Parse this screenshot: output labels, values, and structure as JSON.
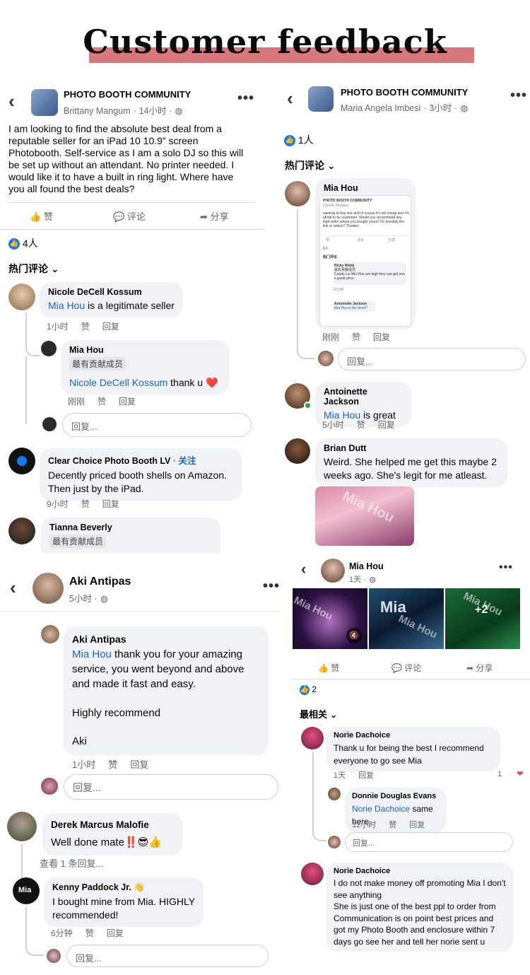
{
  "title": "Customer feedback",
  "p1": {
    "group": "PHOTO BOOTH COMMUNITY",
    "author": "Brittany Mangum",
    "time": "· 14小时 ·",
    "post": "I am looking to find the absolute best deal from a reputable seller for an iPad 10 10.9” screen Photobooth.  Self-service as I am a solo DJ so this will be set up without an attendant.  No printer needed.  I would like it to have a built in ring light. Where have you all found the best deals?",
    "like": "赞",
    "comment": "评论",
    "share": "分享",
    "likes": "4人",
    "sort": "热门评论 ⌄",
    "c1": {
      "name": "Nicole DeCell Kossum",
      "mention": "Mia Hou",
      "text": " is a legitimate seller",
      "time": "1小时",
      "like": "赞",
      "reply": "回复"
    },
    "c2": {
      "name": "Mia Hou",
      "badge": "最有贡献成员",
      "mention": "Nicole DeCell Kossum",
      "text": " thank u ❤️",
      "time": "刚刚",
      "like": "赞",
      "reply": "回复"
    },
    "replyph": "回复...",
    "c3": {
      "name": "Clear Choice Photo Booth LV",
      "follow": " · 关注",
      "text": "Decently priced booth shells on Amazon. Then just by the iPad.",
      "time": "9小时",
      "like": "赞",
      "reply": "回复"
    },
    "c4": {
      "name": "Tianna Beverly",
      "badge": "最有贡献成员"
    }
  },
  "p2": {
    "group": "PHOTO BOOTH COMMUNITY",
    "author": "Maria Angela Imbesi",
    "time": "· 3小时 ·",
    "likes": "1人",
    "sort": "热门评论 ⌄",
    "c1": {
      "name": "Mia Hou",
      "time": "刚刚",
      "like": "赞",
      "reply": "回复"
    },
    "mini": {
      "group": "PHOTO BOOTH COMMUNITY",
      "author": "Camille Morales",
      "post": "wanting to buy one and of course it's not cheap and I'm afraid to be scammed. Would you recommend any legit seller where you bought yours? Or possibly the link or orders? Thanks!",
      "likes": "6人",
      "sort": "热门评论",
      "r1name": "Ricky Webb",
      "r1badge": "最有贡献成员",
      "r1text": "Candy Liu Mia Hou are legit they can get you a great price",
      "r1time": "22分钟",
      "r2name": "Antoinette Jackson",
      "r2text": "Mia Hou is the best!!!",
      "like": "赞",
      "comment": "评论",
      "share": "分享"
    },
    "replyph": "回复...",
    "c2": {
      "name": "Antoinette Jackson",
      "mention": "Mia Hou",
      "text": " is great",
      "time": "5小时",
      "like": "赞",
      "reply": "回复"
    },
    "c3": {
      "name": "Brian Dutt",
      "text": "Weird. She helped me get this maybe 2 weeks ago. She's legit for me atleast."
    },
    "wm": "Mia Hou"
  },
  "p3": {
    "name": "Aki Antipas",
    "time": "5小时 ·",
    "c1": {
      "name": "Aki Antipas",
      "mention": "Mia Hou",
      "text": "  thank you for your amazing service, you went beyond and above and made it fast and easy.",
      "text2": "Highly recommend",
      "text3": "Aki",
      "time": "1小时",
      "like": "赞",
      "reply": "回复"
    },
    "replyph": "回复...",
    "c2": {
      "name": "Derek Marcus Malofie",
      "text": "Well done mate‼️😎👍",
      "more": "查看 1 条回复..."
    },
    "c3": {
      "name": "Kenny Paddock Jr. 👋",
      "text": "I bought mine from Mia. HIGHLY recommended!",
      "time": "6分钟",
      "like": "赞",
      "reply": "回复"
    }
  },
  "p4": {
    "name": "Mia Hou",
    "time": "1天 ·",
    "plus": "+2",
    "imgtext": "Mia",
    "wm": "Mia Hou",
    "like": "赞",
    "comment": "评论",
    "share": "分享",
    "likes": "2",
    "sort": "最相关 ⌄",
    "c1": {
      "name": "Norie Dachoice",
      "text": "Thank u for being the best I recommend everyone to go see Mia",
      "time": "1天",
      "reply": "回复",
      "count": "1"
    },
    "c2": {
      "name": "Donnie Douglas Evans",
      "mention": "Norie Dachoice",
      "text": " same here.",
      "time": "12小时",
      "like": "赞",
      "reply": "回复"
    },
    "replyph": "回复...",
    "c3": {
      "name": "Norie Dachoice",
      "text": "I do not make money off promoting Mia I don't see anything",
      "text2": "She is just one of the best ppl to order from Communication is on point best prices and got my Photo Booth and enclosure within 7 days go see her and tell her norie sent u"
    }
  }
}
